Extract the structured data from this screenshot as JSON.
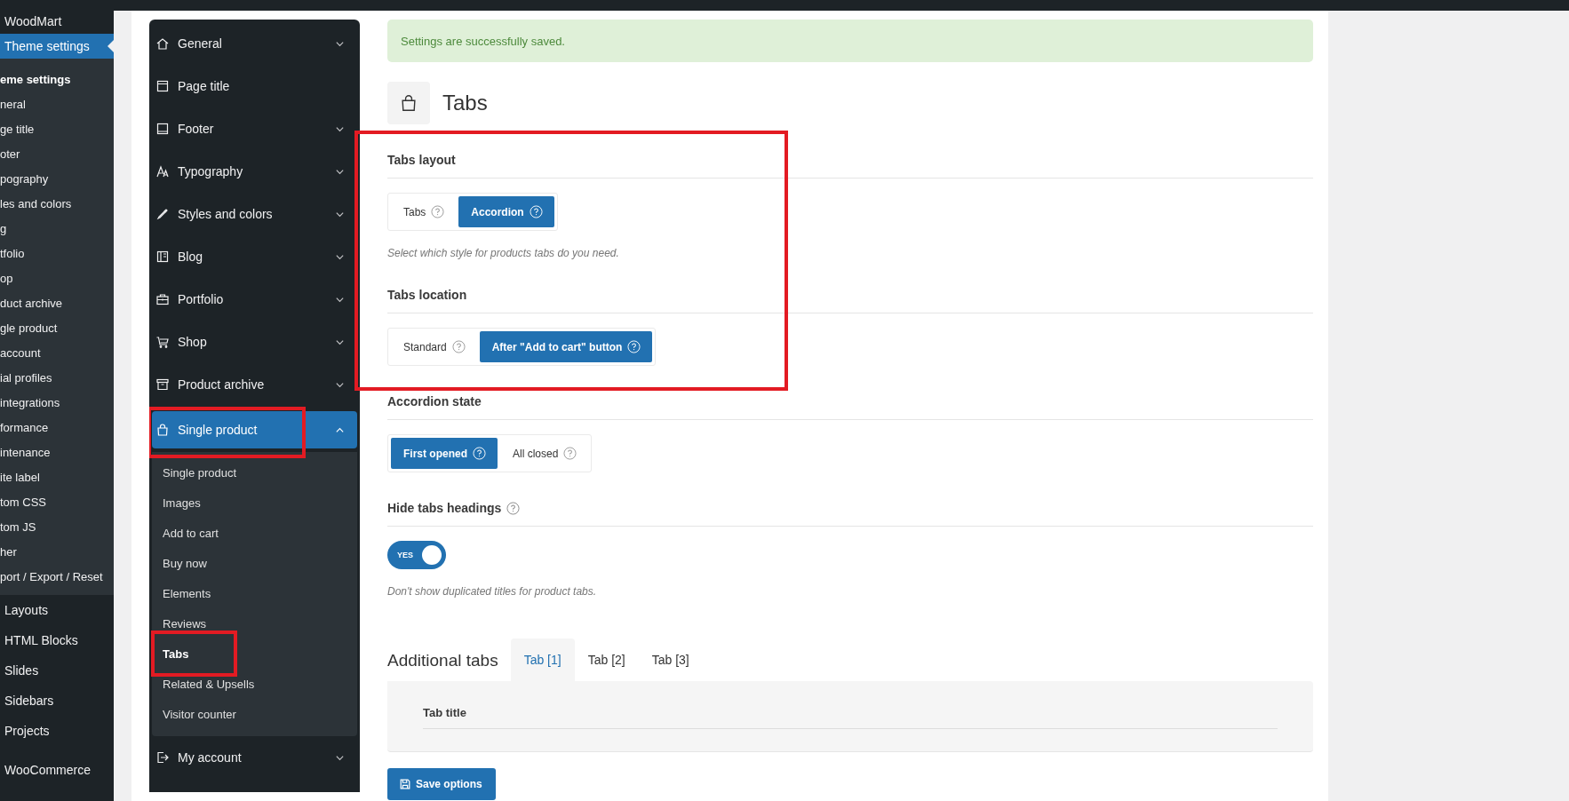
{
  "admin_menu": {
    "items": [
      {
        "label": "WoodMart",
        "selected": false
      },
      {
        "label": "Theme settings",
        "selected": true,
        "children": [
          {
            "label": "eme settings",
            "selected": true
          },
          {
            "label": "neral",
            "selected": false
          },
          {
            "label": "ge title",
            "selected": false
          },
          {
            "label": "oter",
            "selected": false
          },
          {
            "label": "pography",
            "selected": false
          },
          {
            "label": "les and colors",
            "selected": false
          },
          {
            "label": "g",
            "selected": false
          },
          {
            "label": "tfolio",
            "selected": false
          },
          {
            "label": "op",
            "selected": false
          },
          {
            "label": "duct archive",
            "selected": false
          },
          {
            "label": "gle product",
            "selected": false
          },
          {
            "label": "account",
            "selected": false
          },
          {
            "label": "ial profiles",
            "selected": false
          },
          {
            "label": "integrations",
            "selected": false
          },
          {
            "label": "formance",
            "selected": false
          },
          {
            "label": "intenance",
            "selected": false
          },
          {
            "label": "ite label",
            "selected": false
          },
          {
            "label": "tom CSS",
            "selected": false
          },
          {
            "label": "tom JS",
            "selected": false
          },
          {
            "label": "her",
            "selected": false
          },
          {
            "label": "port / Export / Reset",
            "selected": false
          }
        ]
      },
      {
        "label": "Layouts",
        "selected": false
      },
      {
        "label": "HTML Blocks",
        "selected": false
      },
      {
        "label": "Slides",
        "selected": false
      },
      {
        "label": "Sidebars",
        "selected": false
      },
      {
        "label": "Projects",
        "selected": false
      },
      {
        "label": "WooCommerce",
        "selected": false
      }
    ]
  },
  "theme_nav": {
    "items": [
      {
        "label": "General",
        "expandable": true,
        "expanded": false,
        "selected": false,
        "highlighted": false
      },
      {
        "label": "Page title",
        "expandable": false,
        "selected": false,
        "highlighted": false
      },
      {
        "label": "Footer",
        "expandable": true,
        "expanded": false,
        "selected": false,
        "highlighted": false
      },
      {
        "label": "Typography",
        "expandable": true,
        "expanded": false,
        "selected": false,
        "highlighted": false
      },
      {
        "label": "Styles and colors",
        "expandable": true,
        "expanded": false,
        "selected": false,
        "highlighted": false
      },
      {
        "label": "Blog",
        "expandable": true,
        "expanded": false,
        "selected": false,
        "highlighted": false
      },
      {
        "label": "Portfolio",
        "expandable": true,
        "expanded": false,
        "selected": false,
        "highlighted": false
      },
      {
        "label": "Shop",
        "expandable": true,
        "expanded": false,
        "selected": false,
        "highlighted": false
      },
      {
        "label": "Product archive",
        "expandable": true,
        "expanded": false,
        "selected": false,
        "highlighted": false
      },
      {
        "label": "Single product",
        "expandable": true,
        "expanded": true,
        "selected": true,
        "highlighted": true,
        "children": [
          {
            "label": "Single product",
            "selected": false,
            "highlighted": false
          },
          {
            "label": "Images",
            "selected": false,
            "highlighted": false
          },
          {
            "label": "Add to cart",
            "selected": false,
            "highlighted": false
          },
          {
            "label": "Buy now",
            "selected": false,
            "highlighted": false
          },
          {
            "label": "Elements",
            "selected": false,
            "highlighted": false
          },
          {
            "label": "Reviews",
            "selected": false,
            "highlighted": false
          },
          {
            "label": "Tabs",
            "selected": true,
            "highlighted": true
          },
          {
            "label": "Related & Upsells",
            "selected": false,
            "highlighted": false
          },
          {
            "label": "Visitor counter",
            "selected": false,
            "highlighted": false
          }
        ]
      },
      {
        "label": "My account",
        "expandable": true,
        "expanded": false,
        "selected": false,
        "highlighted": false
      }
    ]
  },
  "notice": "Settings are successfully saved.",
  "page_title": "Tabs",
  "settings": [
    {
      "kind": "choice",
      "label": "Tabs layout",
      "highlighted": true,
      "options": [
        {
          "label": "Tabs",
          "selected": false
        },
        {
          "label": "Accordion",
          "selected": true
        }
      ],
      "description": "Select which style for products tabs do you need."
    },
    {
      "kind": "choice",
      "label": "Tabs location",
      "highlighted": true,
      "options": [
        {
          "label": "Standard",
          "selected": false
        },
        {
          "label": "After \"Add to cart\" button",
          "selected": true
        }
      ]
    },
    {
      "kind": "choice",
      "label": "Accordion state",
      "highlighted": false,
      "options": [
        {
          "label": "First opened",
          "selected": true
        },
        {
          "label": "All closed",
          "selected": false
        }
      ]
    },
    {
      "kind": "toggle",
      "label": "Hide tabs headings",
      "help": true,
      "highlighted": false,
      "on": true,
      "on_label": "YES",
      "description": "Don't show duplicated titles for product tabs."
    }
  ],
  "additional_tabs": {
    "title": "Additional tabs",
    "tabs": [
      {
        "label": "Tab [1]",
        "selected": true
      },
      {
        "label": "Tab [2]",
        "selected": false
      },
      {
        "label": "Tab [3]",
        "selected": false
      }
    ],
    "field_label": "Tab title"
  },
  "save_button": "Save options"
}
